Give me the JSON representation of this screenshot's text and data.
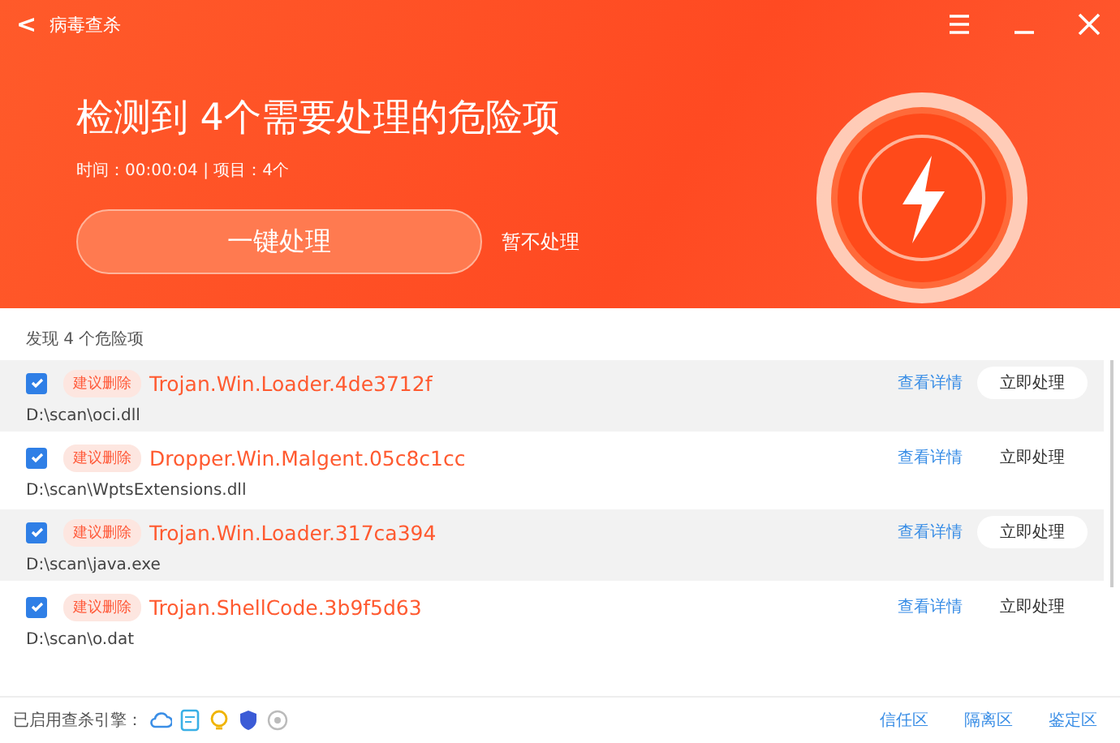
{
  "window": {
    "title": "病毒查杀",
    "back_icon": "<"
  },
  "summary": {
    "heading": "检测到 4个需要处理的危险项",
    "meta": "时间：00:00:04 | 项目：4个",
    "primary_button": "一键处理",
    "secondary_link": "暂不处理"
  },
  "list": {
    "caption": "发现 4 个危险项",
    "items": [
      {
        "checked": true,
        "highlighted": true,
        "tag": "建议删除",
        "name": "Trojan.Win.Loader.4de3712f",
        "path": "D:\\scan\\oci.dll",
        "details_link": "查看详情",
        "action": "立即处理"
      },
      {
        "checked": true,
        "highlighted": false,
        "tag": "建议删除",
        "name": "Dropper.Win.Malgent.05c8c1cc",
        "path": "D:\\scan\\WptsExtensions.dll",
        "details_link": "查看详情",
        "action": "立即处理"
      },
      {
        "checked": true,
        "highlighted": true,
        "tag": "建议删除",
        "name": "Trojan.Win.Loader.317ca394",
        "path": "D:\\scan\\java.exe",
        "details_link": "查看详情",
        "action": "立即处理"
      },
      {
        "checked": true,
        "highlighted": false,
        "tag": "建议删除",
        "name": "Trojan.ShellCode.3b9f5d63",
        "path": "D:\\scan\\o.dat",
        "details_link": "查看详情",
        "action": "立即处理"
      }
    ]
  },
  "status_bar": {
    "engines_label": "已启用查杀引擎：",
    "links": [
      "信任区",
      "隔离区",
      "鉴定区"
    ]
  }
}
